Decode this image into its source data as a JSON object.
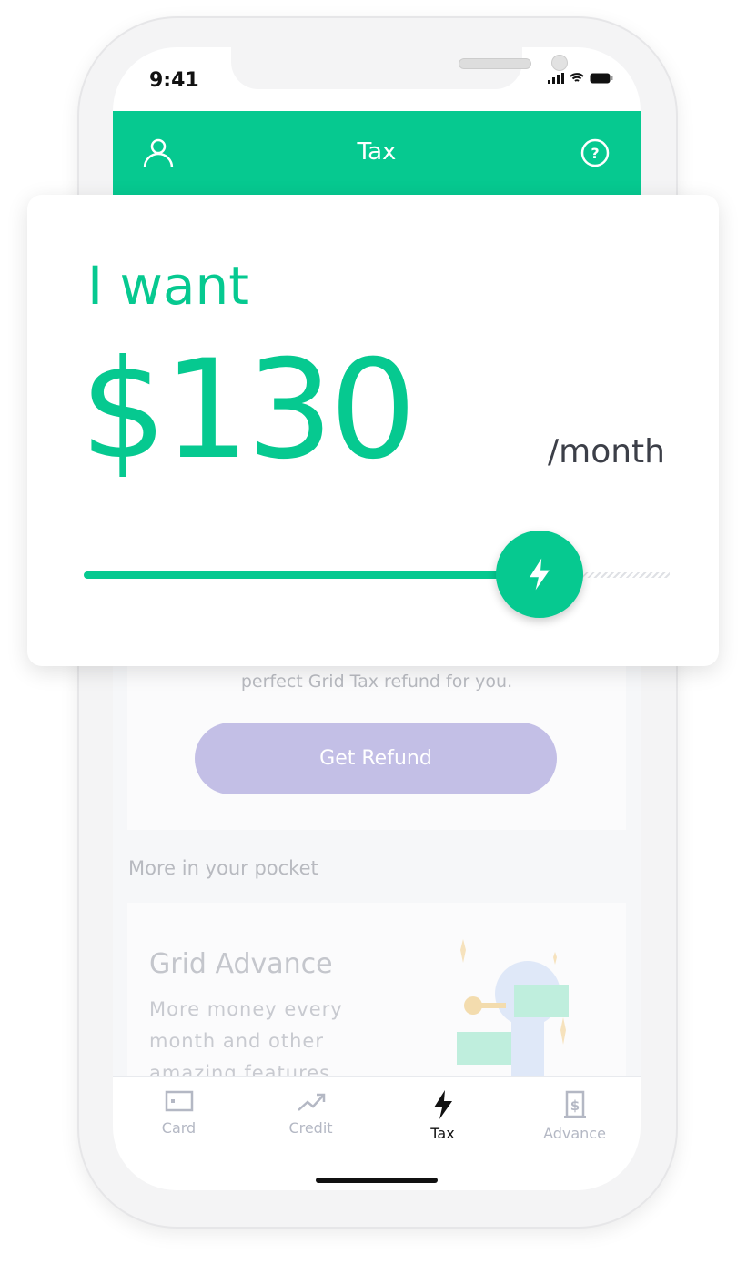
{
  "status_bar": {
    "time": "9:41"
  },
  "header": {
    "title": "Tax",
    "left_icon": "user-icon",
    "right_icon": "help-icon"
  },
  "sheet": {
    "label": "I want",
    "amount": "$130",
    "period": "/month",
    "slider": {
      "value_fraction": 0.8,
      "thumb_icon": "lightning-icon"
    }
  },
  "content": {
    "refund_text": "perfect Grid Tax refund for you.",
    "refund_button": "Get Refund",
    "section_title": "More in your pocket",
    "promo": {
      "title": "Grid Advance",
      "description": "More money every month and other amazing features"
    }
  },
  "nav": {
    "items": [
      {
        "label": "Card",
        "icon": "card-icon"
      },
      {
        "label": "Credit",
        "icon": "trend-up-icon"
      },
      {
        "label": "Tax",
        "icon": "lightning-icon",
        "active": true
      },
      {
        "label": "Advance",
        "icon": "dollar-door-icon"
      }
    ]
  },
  "colors": {
    "brand": "#06c990",
    "button": "#c3bfe6"
  }
}
